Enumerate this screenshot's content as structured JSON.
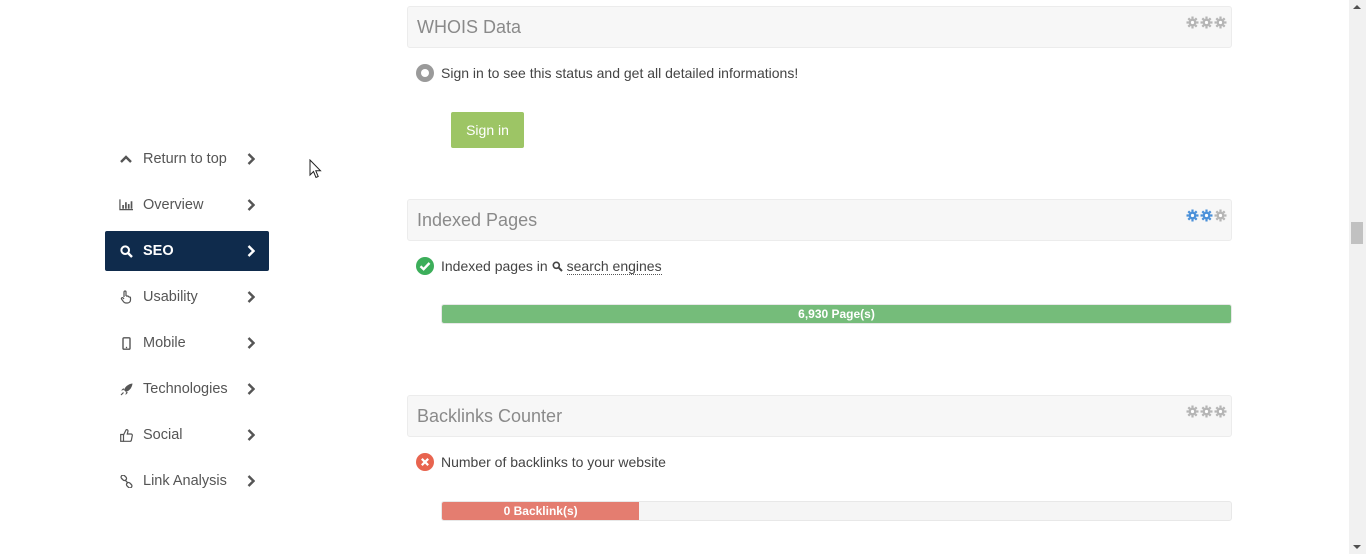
{
  "sidebar": {
    "items": [
      {
        "label": "Return to top",
        "icon": "chevron-up-icon"
      },
      {
        "label": "Overview",
        "icon": "bar-chart-icon"
      },
      {
        "label": "SEO",
        "icon": "search-icon",
        "active": true
      },
      {
        "label": "Usability",
        "icon": "pointer-hand-icon"
      },
      {
        "label": "Mobile",
        "icon": "mobile-icon"
      },
      {
        "label": "Technologies",
        "icon": "rocket-icon"
      },
      {
        "label": "Social",
        "icon": "thumbs-up-icon"
      },
      {
        "label": "Link Analysis",
        "icon": "link-icon"
      }
    ]
  },
  "sections": {
    "whois": {
      "title": "WHOIS Data",
      "status_text": "Sign in to see this status and get all detailed informations!",
      "status_icon": "neutral-circle-icon",
      "button_label": "Sign in"
    },
    "indexed": {
      "title": "Indexed Pages",
      "status_text_prefix": "Indexed pages in",
      "status_link": "search engines",
      "status_icon": "check-circle-icon",
      "bar_label": "6,930 Page(s)",
      "bar_fill_fraction": 1.0
    },
    "backlinks": {
      "title": "Backlinks Counter",
      "status_text": "Number of backlinks to your website",
      "status_icon": "error-circle-icon",
      "bar_label": "0 Backlink(s)",
      "bar_fill_fraction": 0.25
    }
  },
  "colors": {
    "sidebar_active": "#0f2b4c",
    "signin_button": "#9dc565",
    "bar_green": "#75bc7a",
    "bar_red": "#e47d70",
    "status_ok": "#3cae5a",
    "status_error": "#e8644f",
    "gear_active": "#4a90d9",
    "gear_inactive": "#b5b5b5"
  }
}
